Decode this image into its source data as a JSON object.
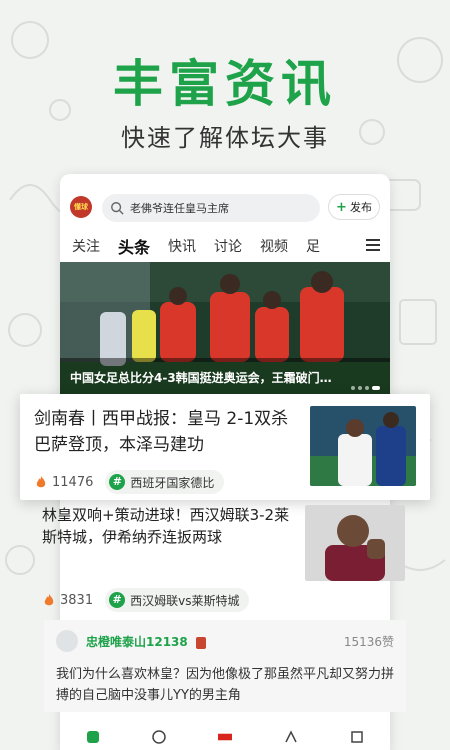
{
  "hero": {
    "title": "丰富资讯",
    "subtitle": "快速了解体坛大事"
  },
  "app": {
    "avatar_text": "懂球",
    "search_placeholder": "老佛爷连任皇马主席",
    "post_button": "发布",
    "tabs": [
      "关注",
      "头条",
      "快讯",
      "讨论",
      "视频",
      "足"
    ],
    "active_tab": "头条",
    "banner_caption": "中国女足总比分4-3韩国挺进奥运会，王霜破门…"
  },
  "featured": {
    "title": "剑南春丨西甲战报：皇马 2-1双杀巴萨登顶，本泽马建功",
    "count": "11476",
    "tag": "西班牙国家德比"
  },
  "article2": {
    "title": "林皇双响+策动进球！西汉姆联3-2莱斯特城，伊希纳乔连扳两球",
    "count": "3831",
    "tag": "西汉姆联vs莱斯特城"
  },
  "comment": {
    "user": "忠橙唯泰山12138",
    "likes": "15136赞",
    "text": "我们为什么喜欢林皇？因为他像极了那虽然平凡却又努力拼搏的自己脑中没事儿YY的男主角"
  },
  "colors": {
    "accent": "#1ea34a",
    "flame": "#f07a2b"
  }
}
